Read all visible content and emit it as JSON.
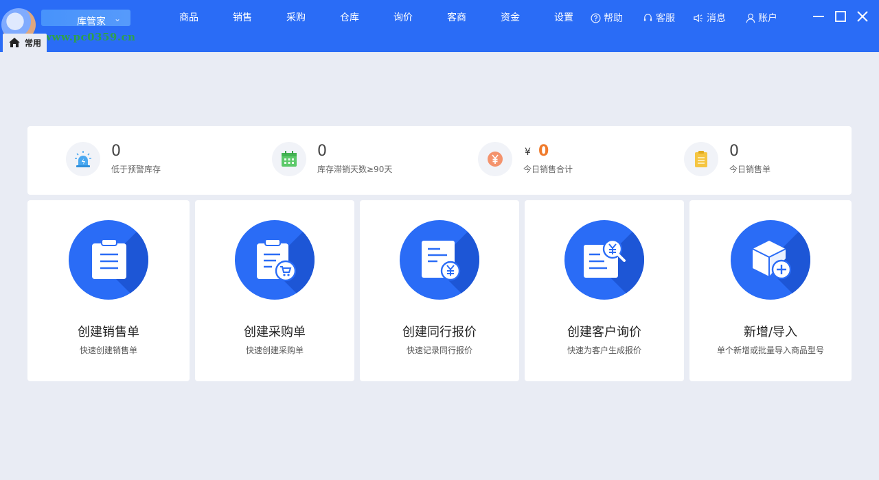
{
  "app": {
    "brand": "库管家",
    "watermark": "www.pc0359.cn"
  },
  "nav": {
    "items": [
      {
        "label": "商品"
      },
      {
        "label": "销售"
      },
      {
        "label": "采购"
      },
      {
        "label": "仓库"
      },
      {
        "label": "询价"
      },
      {
        "label": "客商"
      },
      {
        "label": "资金"
      },
      {
        "label": "设置"
      }
    ]
  },
  "utility": {
    "help": "帮助",
    "service": "客服",
    "message": "消息",
    "account": "账户"
  },
  "tab": {
    "home_label": "常用"
  },
  "stats": [
    {
      "value": "0",
      "label": "低于预警库存",
      "icon": "alarm-icon",
      "color": "#4aa8f0"
    },
    {
      "value": "0",
      "label": "库存滞销天数≥90天",
      "icon": "calendar-icon",
      "color": "#5cc96a"
    },
    {
      "currency": "¥",
      "value": "0",
      "label": "今日销售合计",
      "icon": "yen-icon",
      "color": "#f4936d"
    },
    {
      "value": "0",
      "label": "今日销售单",
      "icon": "clipboard-icon",
      "color": "#f5c542"
    }
  ],
  "actions": [
    {
      "title": "创建销售单",
      "subtitle": "快速创建销售单",
      "icon": "clipboard-icon"
    },
    {
      "title": "创建采购单",
      "subtitle": "快速创建采购单",
      "icon": "clipboard-cart-icon"
    },
    {
      "title": "创建同行报价",
      "subtitle": "快速记录同行报价",
      "icon": "document-yen-icon"
    },
    {
      "title": "创建客户询价",
      "subtitle": "快速为客户生成报价",
      "icon": "document-search-yen-icon"
    },
    {
      "title": "新增/导入",
      "subtitle": "单个新增或批量导入商品型号",
      "icon": "box-add-icon"
    }
  ],
  "colors": {
    "primary": "#2a6cf6",
    "background": "#e9ecf4",
    "highlight": "#f07b2c"
  }
}
